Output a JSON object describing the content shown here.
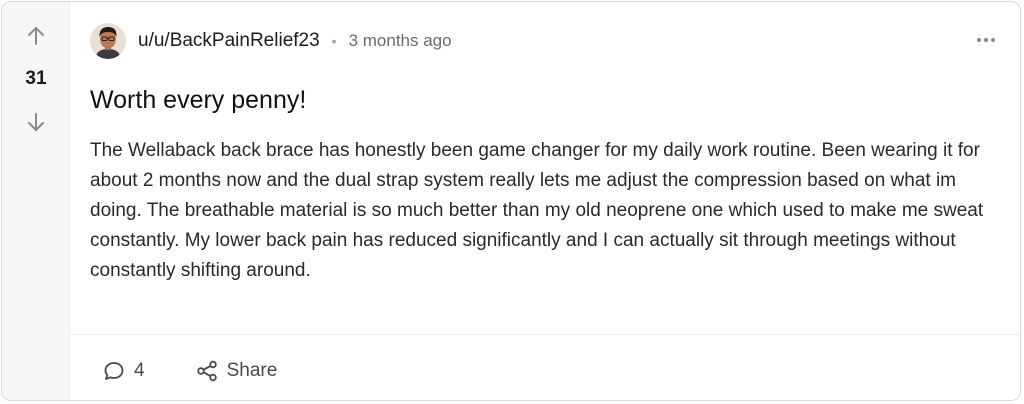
{
  "post": {
    "votes": "31",
    "author": "u/u/BackPainRelief23",
    "separator": "•",
    "time_ago": "3 months ago",
    "title": "Worth every penny!",
    "body": "The Wellaback back brace has honestly been game changer for my daily work routine. Been wearing it for about 2 months now and the dual strap system really lets me adjust the compression based on what im doing. The breathable material is so much better than my old neoprene one which used to make me sweat constantly. My lower back pain has reduced significantly and I can actually sit through meetings without constantly shifting around.",
    "comment_count": "4",
    "share_label": "Share"
  },
  "icons": {
    "upvote": "arrow-up-icon",
    "downvote": "arrow-down-icon",
    "more": "more-horizontal-icon",
    "comment": "comment-bubble-icon",
    "share": "share-icon"
  },
  "colors": {
    "vote_column_bg": "#f7f7f8",
    "border": "#d9d9d9",
    "muted_text": "#6b6b6b"
  }
}
